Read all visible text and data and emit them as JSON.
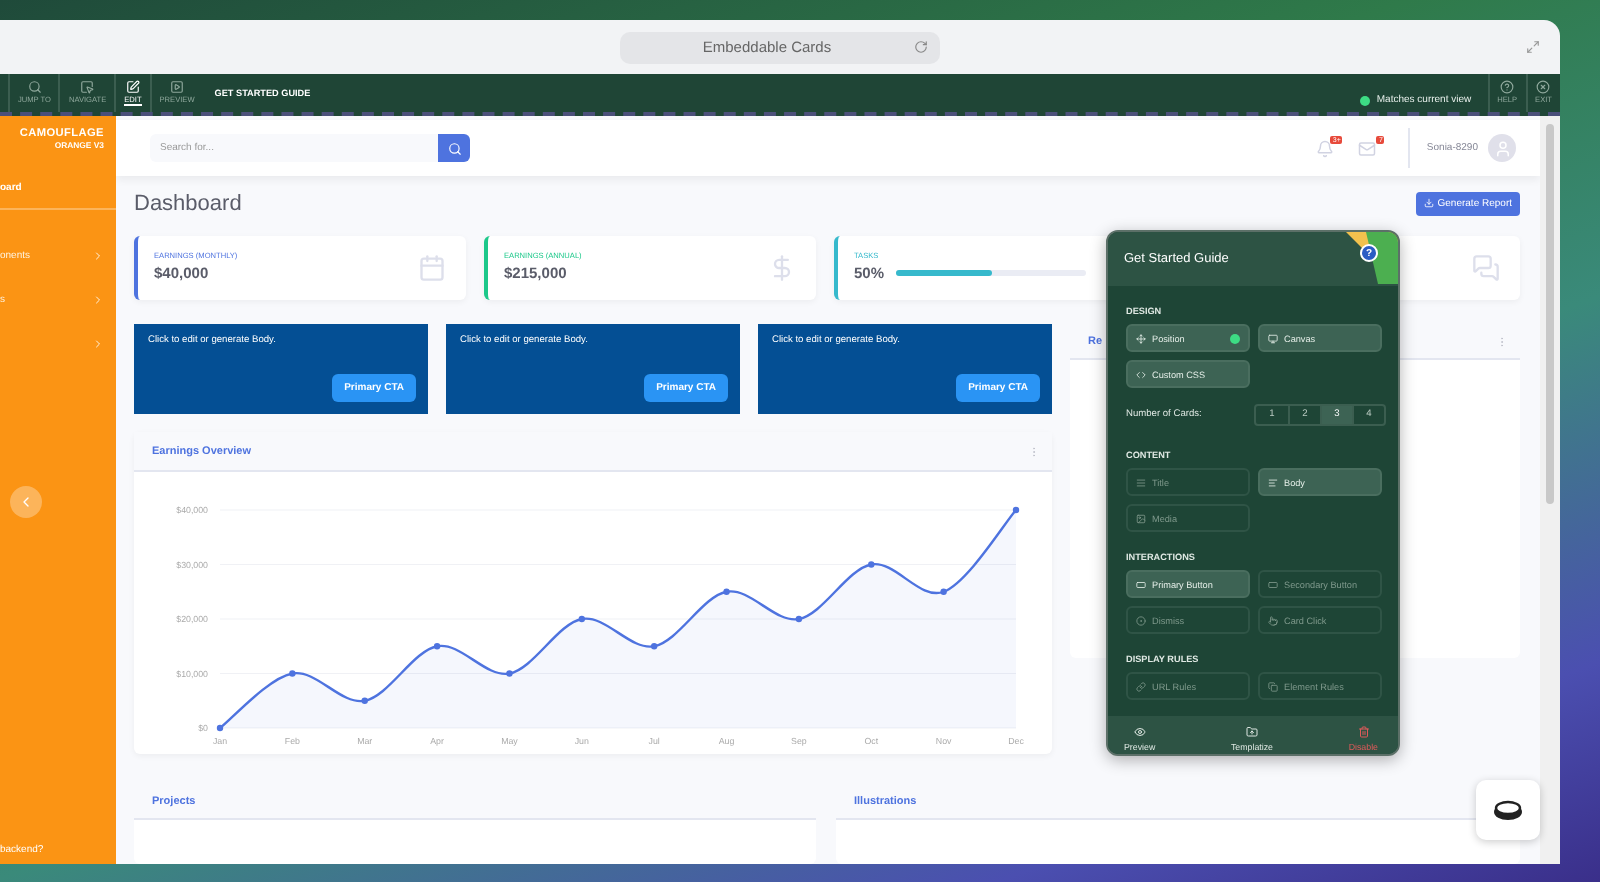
{
  "browser": {
    "address": "Embeddable Cards"
  },
  "toolbar": {
    "tools": [
      {
        "label": "JUMP TO",
        "selected": false
      },
      {
        "label": "NAVIGATE",
        "selected": false
      },
      {
        "label": "EDIT",
        "selected": true
      },
      {
        "label": "PREVIEW",
        "selected": false
      }
    ],
    "guide_label": "GET STARTED GUIDE",
    "status": "Matches current view",
    "right_tools": [
      "HELP",
      "EXIT"
    ]
  },
  "sidebar": {
    "brand": "CAMOUFLAGE",
    "brand_sub": "ORANGE V3",
    "items": [
      {
        "label": "oard",
        "has_arrow": false,
        "active": true
      },
      {
        "label": "onents",
        "has_arrow": true,
        "active": false
      },
      {
        "label": "s",
        "has_arrow": true,
        "active": false
      },
      {
        "has_arrow": true,
        "active": false
      }
    ],
    "footer": "backend?"
  },
  "topbar": {
    "search_placeholder": "Search for...",
    "alerts_badge": "3+",
    "messages_badge": "7",
    "user": "Sonia-8290"
  },
  "page": {
    "title": "Dashboard",
    "action": "Generate Report"
  },
  "stats": [
    {
      "kind": "value",
      "label": "EARNINGS (MONTHLY)",
      "value": "$40,000",
      "color": "#4e73df"
    },
    {
      "kind": "value",
      "label": "EARNINGS (ANNUAL)",
      "value": "$215,000",
      "color": "#1cc88a"
    },
    {
      "kind": "progress",
      "label": "TASKS",
      "value": "50%",
      "level": 0.5,
      "color": "#36b9cc"
    },
    {
      "kind": "covered"
    }
  ],
  "cta_cards": [
    {
      "body": "Click to edit or generate Body.",
      "button": "Primary CTA"
    },
    {
      "body": "Click to edit or generate Body.",
      "button": "Primary CTA"
    },
    {
      "body": "Click to edit or generate Body.",
      "button": "Primary CTA"
    }
  ],
  "side_card": {
    "title": "Re"
  },
  "earnings": {
    "title": "Earnings Overview",
    "chart_data": {
      "type": "area",
      "categories": [
        "Jan",
        "Feb",
        "Mar",
        "Apr",
        "May",
        "Jun",
        "Jul",
        "Aug",
        "Sep",
        "Oct",
        "Nov",
        "Dec"
      ],
      "grid": true,
      "series": [
        {
          "color": "#4e73df",
          "values": [
            0,
            10000,
            5000,
            15000,
            10000,
            20000,
            15000,
            25000,
            20000,
            30000,
            25000,
            40000
          ]
        }
      ],
      "ylim": [
        0,
        40000
      ],
      "yticks": [
        {
          "value": 0,
          "label": "$0"
        },
        {
          "value": 10000,
          "label": "$10,000"
        },
        {
          "value": 20000,
          "label": "$20,000"
        },
        {
          "value": 30000,
          "label": "$30,000"
        },
        {
          "value": 40000,
          "label": "$40,000"
        }
      ]
    }
  },
  "bottom_cards": [
    {
      "title": "Projects"
    },
    {
      "title": "Illustrations"
    }
  ],
  "guide": {
    "title": "Get Started Guide",
    "help": "?",
    "sections": [
      {
        "title": "DESIGN",
        "options": [
          {
            "label": "Position",
            "selected": true,
            "status_dot": true
          },
          {
            "label": "Canvas",
            "selected": true,
            "status_dot": false
          },
          {
            "label": "Custom CSS",
            "selected": true,
            "status_dot": false
          }
        ],
        "counter": {
          "label": "Number of Cards:",
          "choices": [
            {
              "label": "1",
              "selected": false
            },
            {
              "label": "2",
              "selected": false
            },
            {
              "label": "3",
              "selected": true
            },
            {
              "label": "4",
              "selected": false
            }
          ]
        }
      },
      {
        "title": "CONTENT",
        "options": [
          {
            "label": "Title",
            "selected": false,
            "status_dot": false
          },
          {
            "label": "Body",
            "selected": true,
            "status_dot": false
          },
          {
            "label": "Media",
            "selected": false,
            "status_dot": false
          }
        ]
      },
      {
        "title": "INTERACTIONS",
        "options": [
          {
            "label": "Primary Button",
            "selected": true,
            "status_dot": false
          },
          {
            "label": "Secondary Button",
            "selected": false,
            "status_dot": false
          },
          {
            "label": "Dismiss",
            "selected": false,
            "status_dot": false
          },
          {
            "label": "Card Click",
            "selected": false,
            "status_dot": false
          }
        ]
      },
      {
        "title": "DISPLAY RULES",
        "options": [
          {
            "label": "URL Rules",
            "selected": false,
            "status_dot": false
          },
          {
            "label": "Element Rules",
            "selected": false,
            "status_dot": false
          }
        ]
      }
    ],
    "footer": [
      {
        "label": "Preview",
        "kind": "normal"
      },
      {
        "label": "Templatize",
        "kind": "normal"
      },
      {
        "label": "Disable",
        "kind": "danger"
      }
    ]
  }
}
